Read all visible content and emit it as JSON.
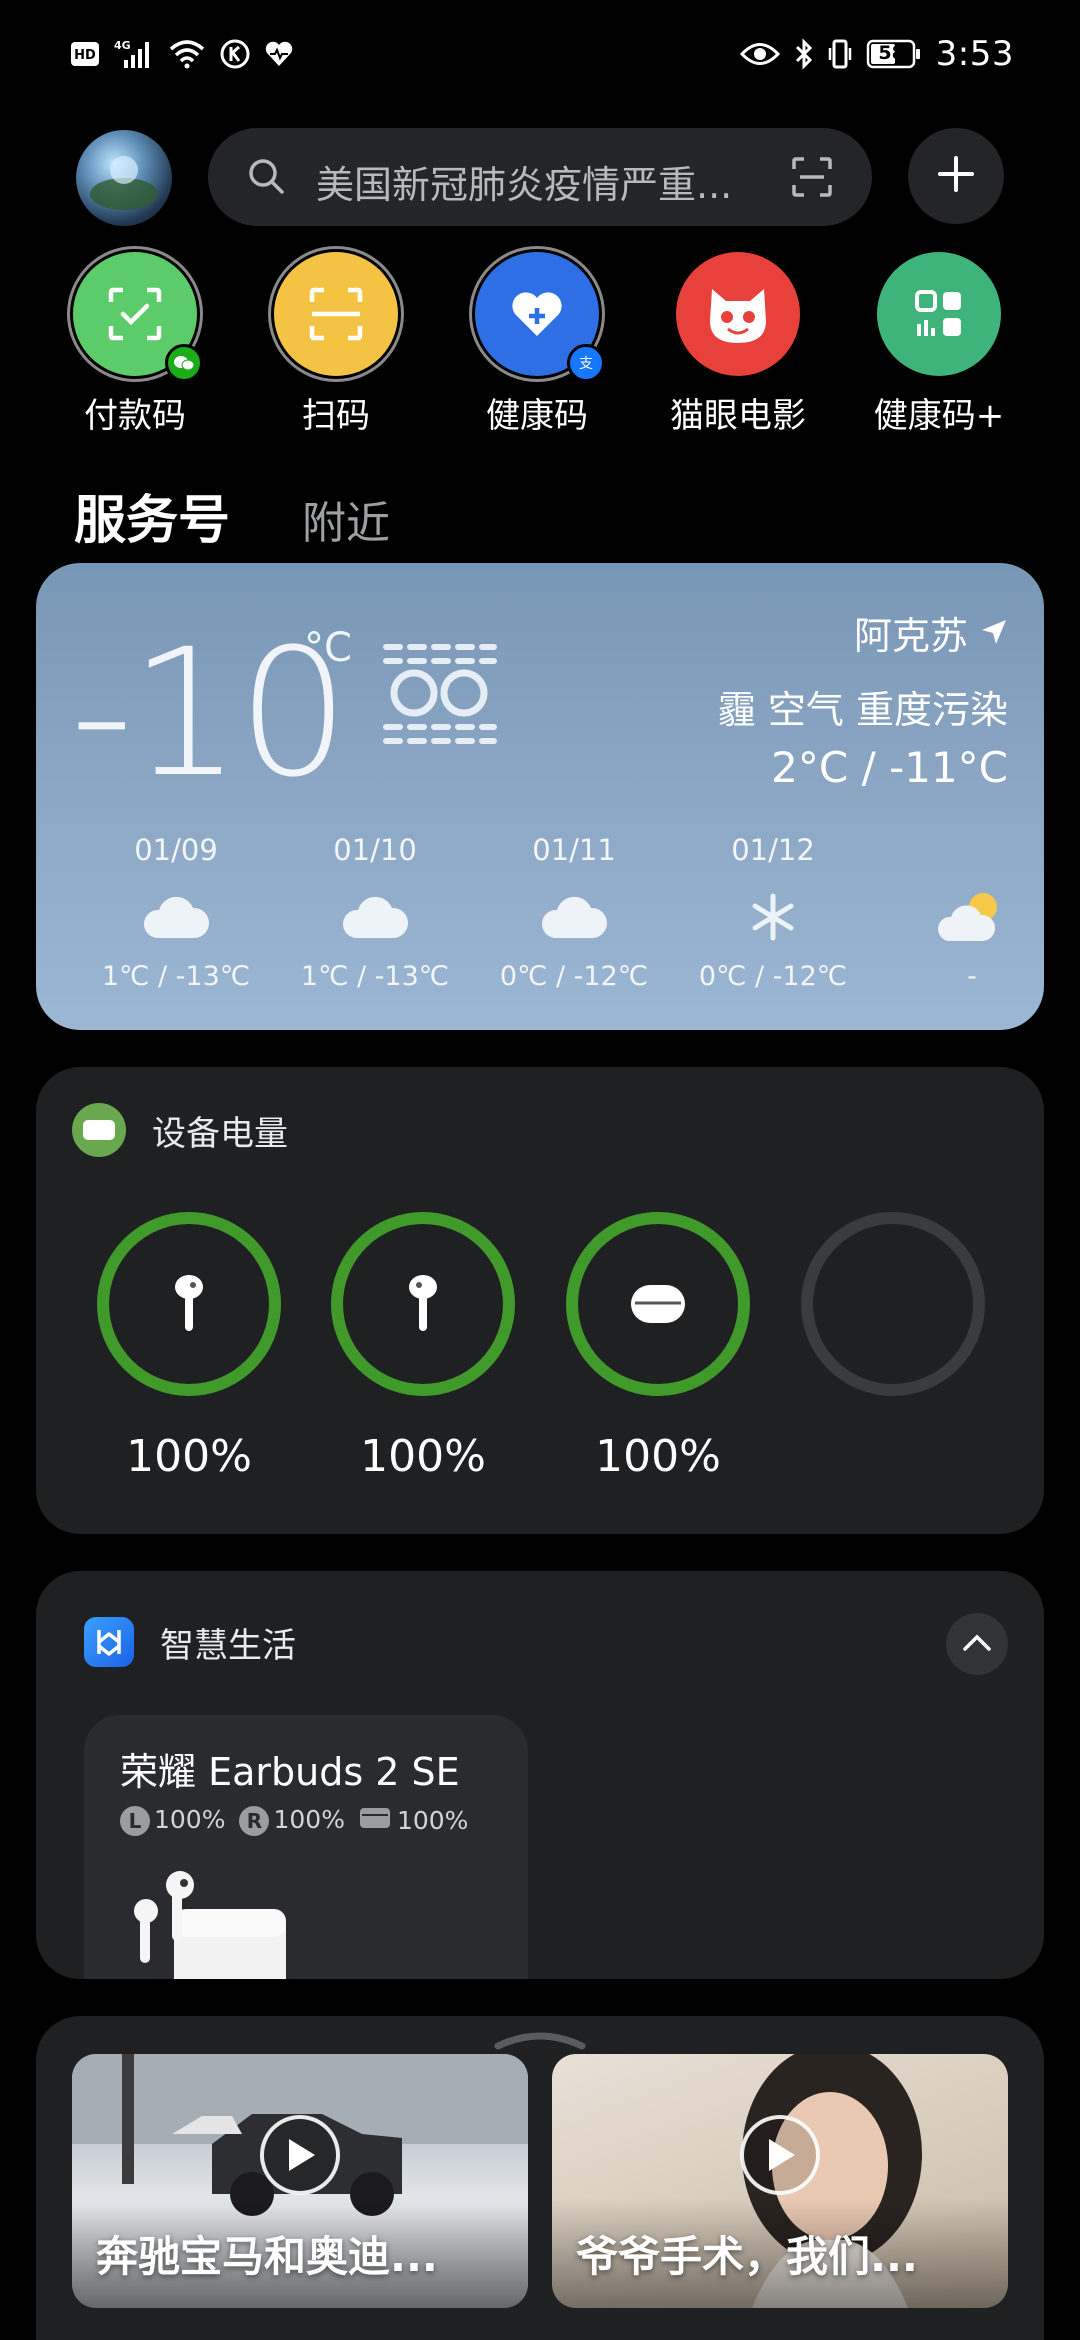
{
  "status_bar": {
    "left_icons": [
      "hd-icon",
      "4g-signal-icon",
      "wifi-icon",
      "k-app-icon",
      "heart-app-icon"
    ],
    "right_icons": [
      "eye-icon",
      "bluetooth-icon",
      "vibrate-icon"
    ],
    "battery_level": "58",
    "time": "3:53"
  },
  "search": {
    "placeholder": "美国新冠肺炎疫情严重..."
  },
  "quick_actions": [
    {
      "label": "付款码",
      "color": "#5ccc6a",
      "icon": "payment-code-icon"
    },
    {
      "label": "扫码",
      "color": "#f5c344",
      "icon": "scan-icon"
    },
    {
      "label": "健康码",
      "color": "#2f6fe6",
      "icon": "health-code-icon"
    },
    {
      "label": "猫眼电影",
      "color": "#e8403a",
      "icon": "maoyan-cat-icon"
    },
    {
      "label": "健康码+",
      "color": "#3fb47a",
      "icon": "health-code-plus-icon"
    }
  ],
  "tabs": {
    "active": "服务号",
    "other": "附近"
  },
  "weather": {
    "temp": "-10",
    "unit": "°C",
    "city": "阿克苏",
    "aqi_text": "霾  空气 重度污染",
    "range": "2°C / -11°C",
    "forecast": [
      {
        "date": "01/09",
        "icon": "cloud-icon",
        "temp": "1℃ / -13℃"
      },
      {
        "date": "01/10",
        "icon": "cloud-icon",
        "temp": "1℃ / -13℃"
      },
      {
        "date": "01/11",
        "icon": "cloud-icon",
        "temp": "0℃ / -12℃"
      },
      {
        "date": "01/12",
        "icon": "snow-icon",
        "temp": "0℃ / -12℃"
      },
      {
        "date": "",
        "icon": "partly-cloudy-icon",
        "temp": "-"
      }
    ]
  },
  "battery": {
    "title": "设备电量",
    "devices": [
      {
        "icon": "left-earbud-icon",
        "percent": "100%",
        "level": 1.0
      },
      {
        "icon": "right-earbud-icon",
        "percent": "100%",
        "level": 1.0
      },
      {
        "icon": "earbuds-case-icon",
        "percent": "100%",
        "level": 1.0
      },
      {
        "icon": "",
        "percent": "",
        "level": 0
      }
    ],
    "accent": "#3f9a2a"
  },
  "smart_life": {
    "title": "智慧生活",
    "device": {
      "name": "荣耀 Earbuds 2 SE",
      "left_tag": "L",
      "left": "100%",
      "right_tag": "R",
      "right": "100%",
      "case": "100%"
    }
  },
  "videos": [
    {
      "title": "奔驰宝马和奥迪..."
    },
    {
      "title": "爷爷手术，我们..."
    }
  ]
}
